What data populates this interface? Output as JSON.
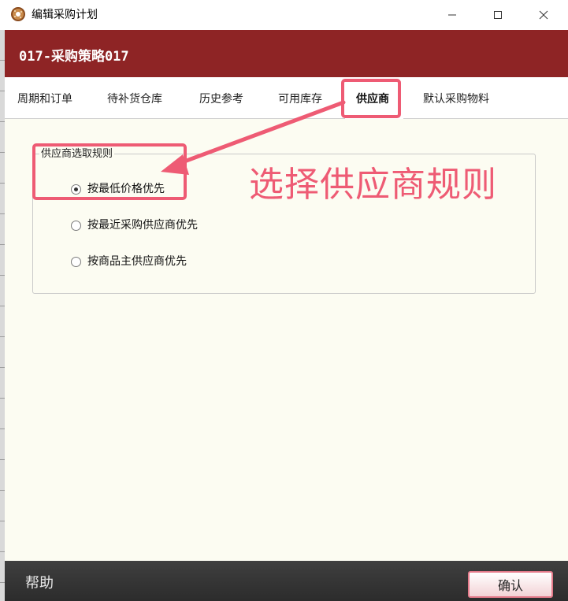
{
  "window": {
    "title": "编辑采购计划",
    "minimize_glyph": "—",
    "maximize_glyph": "☐",
    "close_glyph": "✕"
  },
  "header": {
    "title": "017-采购策略017",
    "background_color": "#8e2425"
  },
  "tabs": [
    {
      "label": "周期和订单",
      "active": false
    },
    {
      "label": "待补货仓库",
      "active": false
    },
    {
      "label": "历史参考",
      "active": false
    },
    {
      "label": "可用库存",
      "active": false
    },
    {
      "label": "供应商",
      "active": true
    },
    {
      "label": "默认采购物料",
      "active": false
    }
  ],
  "supplier_rules": {
    "group_label": "供应商选取规则",
    "options": [
      {
        "label": "按最低价格优先",
        "checked": true
      },
      {
        "label": "按最近采购供应商优先",
        "checked": false
      },
      {
        "label": "按商品主供应商优先",
        "checked": false
      }
    ]
  },
  "annotation": {
    "text": "选择供应商规则",
    "color": "#ee5b74"
  },
  "footer": {
    "help_label": "帮助",
    "confirm_label": "确认"
  },
  "icons": {
    "app": "donut-app-icon",
    "minimize": "minimize-icon",
    "maximize": "maximize-icon",
    "close": "close-icon"
  }
}
